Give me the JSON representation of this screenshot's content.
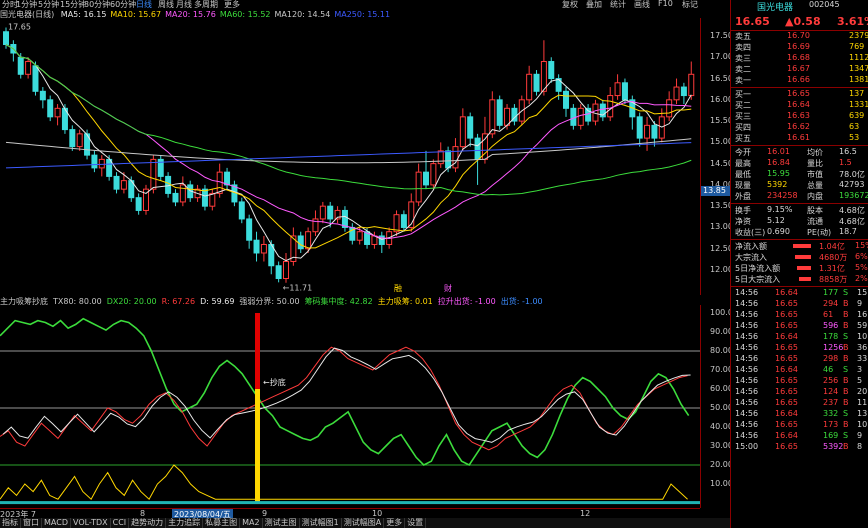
{
  "toolbar": {
    "periods": [
      "分时",
      "1分钟",
      "5分钟",
      "15分钟",
      "30分钟",
      "60分钟",
      "日线",
      "周线",
      "月线",
      "多周期",
      "更多"
    ],
    "active": "日线",
    "right_tools": [
      "复权",
      "叠加",
      "统计",
      "画线",
      "F10",
      "标记"
    ]
  },
  "chart_title": "国光电器(日线)",
  "ma_legend": [
    {
      "label": "MA5: 16.15",
      "color": "#e8e8e8"
    },
    {
      "label": "MA10: 15.67",
      "color": "#ffd700"
    },
    {
      "label": "MA20: 15.76",
      "color": "#ff5aff"
    },
    {
      "label": "MA60: 15.52",
      "color": "#3cdc3c"
    },
    {
      "label": "MA120: 14.54",
      "color": "#c8c8c8"
    },
    {
      "label": "MA250: 15.11",
      "color": "#3c5aff"
    }
  ],
  "price_axis": [
    "17.50",
    "17.00",
    "16.50",
    "16.00",
    "15.50",
    "15.00",
    "14.50",
    "14.00",
    "13.50",
    "13.00",
    "12.50",
    "12.00"
  ],
  "axis_tag": "13.85",
  "annotations": {
    "high": "17.65",
    "low": "11.71",
    "marks": [
      "融",
      "财"
    ]
  },
  "candles": [
    [
      17.6,
      17.3,
      17.7,
      17.2
    ],
    [
      17.3,
      17.1,
      17.4,
      16.9
    ],
    [
      17.0,
      16.6,
      17.1,
      16.5
    ],
    [
      16.6,
      16.9,
      17.0,
      16.5
    ],
    [
      16.8,
      16.2,
      16.9,
      16.1
    ],
    [
      16.2,
      16.0,
      16.3,
      15.8
    ],
    [
      16.0,
      15.6,
      16.1,
      15.5
    ],
    [
      15.6,
      15.8,
      15.9,
      15.4
    ],
    [
      15.8,
      15.3,
      15.9,
      15.2
    ],
    [
      15.3,
      14.9,
      15.4,
      14.8
    ],
    [
      14.9,
      15.2,
      15.3,
      14.8
    ],
    [
      15.2,
      14.7,
      15.3,
      14.6
    ],
    [
      14.7,
      14.4,
      14.8,
      14.3
    ],
    [
      14.4,
      14.6,
      14.7,
      14.2
    ],
    [
      14.6,
      14.2,
      14.7,
      14.1
    ],
    [
      14.2,
      13.9,
      14.3,
      13.8
    ],
    [
      13.9,
      14.1,
      14.3,
      13.8
    ],
    [
      14.1,
      13.7,
      14.2,
      13.6
    ],
    [
      13.7,
      13.4,
      13.8,
      13.3
    ],
    [
      13.4,
      13.9,
      14.0,
      13.3
    ],
    [
      13.9,
      14.6,
      14.7,
      13.8
    ],
    [
      14.6,
      14.2,
      14.7,
      14.1
    ],
    [
      14.2,
      13.8,
      14.3,
      13.7
    ],
    [
      13.8,
      13.6,
      13.9,
      13.5
    ],
    [
      13.6,
      14.0,
      14.2,
      13.5
    ],
    [
      14.0,
      13.7,
      14.1,
      13.6
    ],
    [
      13.7,
      13.9,
      14.0,
      13.6
    ],
    [
      13.9,
      13.5,
      14.0,
      13.4
    ],
    [
      13.5,
      13.8,
      13.9,
      13.4
    ],
    [
      13.8,
      14.3,
      14.5,
      13.7
    ],
    [
      14.3,
      14.0,
      14.4,
      13.9
    ],
    [
      14.0,
      13.6,
      14.1,
      13.5
    ],
    [
      13.6,
      13.2,
      13.7,
      13.1
    ],
    [
      13.2,
      12.7,
      13.3,
      12.5
    ],
    [
      12.7,
      12.4,
      12.9,
      12.2
    ],
    [
      12.4,
      12.6,
      12.8,
      12.2
    ],
    [
      12.6,
      12.1,
      12.7,
      11.9
    ],
    [
      12.1,
      11.8,
      12.2,
      11.71
    ],
    [
      11.8,
      12.2,
      12.4,
      11.7
    ],
    [
      12.2,
      12.8,
      13.0,
      12.1
    ],
    [
      12.8,
      12.5,
      12.9,
      12.4
    ],
    [
      12.5,
      12.9,
      13.0,
      12.4
    ],
    [
      12.9,
      13.2,
      13.4,
      12.8
    ],
    [
      13.2,
      13.5,
      13.6,
      13.1
    ],
    [
      13.5,
      13.2,
      13.6,
      13.0
    ],
    [
      13.2,
      13.4,
      13.5,
      13.1
    ],
    [
      13.4,
      13.0,
      13.5,
      12.9
    ],
    [
      13.0,
      12.7,
      13.1,
      12.6
    ],
    [
      12.7,
      12.9,
      13.0,
      12.6
    ],
    [
      12.9,
      12.6,
      13.0,
      12.5
    ],
    [
      12.6,
      12.8,
      12.9,
      12.5
    ],
    [
      12.8,
      12.6,
      12.9,
      12.4
    ],
    [
      12.6,
      12.9,
      13.0,
      12.5
    ],
    [
      12.9,
      13.3,
      13.4,
      12.8
    ],
    [
      13.3,
      13.0,
      13.4,
      12.9
    ],
    [
      13.0,
      13.6,
      13.8,
      12.9
    ],
    [
      13.6,
      14.3,
      14.5,
      13.5
    ],
    [
      14.3,
      14.0,
      14.8,
      13.9
    ],
    [
      14.0,
      14.5,
      14.6,
      13.9
    ],
    [
      14.5,
      14.8,
      15.0,
      14.4
    ],
    [
      14.8,
      14.4,
      14.9,
      14.3
    ],
    [
      14.4,
      14.9,
      15.1,
      14.3
    ],
    [
      14.9,
      15.6,
      15.8,
      14.8
    ],
    [
      15.6,
      15.1,
      15.7,
      14.9
    ],
    [
      15.1,
      14.6,
      15.2,
      14.0
    ],
    [
      14.6,
      15.2,
      15.6,
      14.5
    ],
    [
      15.2,
      16.0,
      16.2,
      15.1
    ],
    [
      16.0,
      15.4,
      16.1,
      15.3
    ],
    [
      15.4,
      15.8,
      15.9,
      15.3
    ],
    [
      15.8,
      15.5,
      15.9,
      15.4
    ],
    [
      15.5,
      16.0,
      16.1,
      15.4
    ],
    [
      16.0,
      16.6,
      16.8,
      15.9
    ],
    [
      16.6,
      16.2,
      16.7,
      16.1
    ],
    [
      16.2,
      16.9,
      17.4,
      16.1
    ],
    [
      16.9,
      16.5,
      17.0,
      16.4
    ],
    [
      16.5,
      16.2,
      16.6,
      16.0
    ],
    [
      16.2,
      15.8,
      16.3,
      15.6
    ],
    [
      15.8,
      15.4,
      15.9,
      15.3
    ],
    [
      15.4,
      15.8,
      15.9,
      15.3
    ],
    [
      15.8,
      15.5,
      15.9,
      15.4
    ],
    [
      15.5,
      15.9,
      16.0,
      15.4
    ],
    [
      15.9,
      15.6,
      16.0,
      15.5
    ],
    [
      15.6,
      16.1,
      16.3,
      15.5
    ],
    [
      16.1,
      16.4,
      16.6,
      16.0
    ],
    [
      16.4,
      16.0,
      16.5,
      15.9
    ],
    [
      16.0,
      15.6,
      16.1,
      15.3
    ],
    [
      15.6,
      15.1,
      15.7,
      14.9
    ],
    [
      15.1,
      15.4,
      15.6,
      14.8
    ],
    [
      15.4,
      15.1,
      15.5,
      14.9
    ],
    [
      15.1,
      15.6,
      15.8,
      15.0
    ],
    [
      15.6,
      16.0,
      16.2,
      15.5
    ],
    [
      16.0,
      16.3,
      16.5,
      15.9
    ],
    [
      16.3,
      16.1,
      16.4,
      15.9
    ],
    [
      16.1,
      16.6,
      16.9,
      16.0
    ]
  ],
  "indicator_legend": [
    {
      "label": "主力吸筹抄底",
      "color": "#c8c8c8"
    },
    {
      "label": "TX80: 80.00",
      "color": "#c8c8c8"
    },
    {
      "label": "DX20: 20.00",
      "color": "#3cdc3c"
    },
    {
      "label": "R: 67.26",
      "color": "#ff3b3b"
    },
    {
      "label": "D: 59.69",
      "color": "#e8e8e8"
    },
    {
      "label": "强弱分界: 50.00",
      "color": "#c8c8c8"
    },
    {
      "label": "筹码集中度: 42.82",
      "color": "#3cdc3c"
    },
    {
      "label": "主力吸筹: 0.01",
      "color": "#ffd700"
    },
    {
      "label": "拉升出货: -1.00",
      "color": "#ff5aff"
    },
    {
      "label": "出货: -1.00",
      "color": "#3c8cff"
    }
  ],
  "indicator_axis": [
    "100.0",
    "90.00",
    "80.00",
    "70.00",
    "60.00",
    "50.00",
    "40.00",
    "30.00",
    "20.00",
    "10.00"
  ],
  "indicator_annotation": "抄底",
  "date_bar": [
    {
      "text": "2023年 7"
    },
    {
      "text": "8"
    },
    {
      "text": "2023/08/04/五",
      "selected": true
    },
    {
      "text": "9"
    },
    {
      "text": "10"
    },
    {
      "text": "12"
    }
  ],
  "bottom_tabs": [
    "指标",
    "窗口",
    "MACD",
    "VOL-TDX",
    "CCI",
    "趋势动力",
    "主力追踪",
    "私募主图",
    "MA2",
    "测试主图",
    "测试幅图1",
    "测试幅图A",
    "更多",
    "设置"
  ],
  "quote": {
    "name": "国光电器",
    "code": "002045",
    "price": "16.65",
    "change": "▲0.58",
    "pct": "3.61%",
    "asks": [
      {
        "label": "卖五",
        "price": "16.70",
        "vol": "2379"
      },
      {
        "label": "卖四",
        "price": "16.69",
        "vol": "769"
      },
      {
        "label": "卖三",
        "price": "16.68",
        "vol": "1112"
      },
      {
        "label": "卖二",
        "price": "16.67",
        "vol": "1347"
      },
      {
        "label": "卖一",
        "price": "16.66",
        "vol": "1381"
      }
    ],
    "bids": [
      {
        "label": "买一",
        "price": "16.65",
        "vol": "137"
      },
      {
        "label": "买二",
        "price": "16.64",
        "vol": "1331"
      },
      {
        "label": "买三",
        "price": "16.63",
        "vol": "639"
      },
      {
        "label": "买四",
        "price": "16.62",
        "vol": "63"
      },
      {
        "label": "买五",
        "price": "16.61",
        "vol": "53"
      }
    ],
    "stats": [
      {
        "k1": "今开",
        "v1": "16.01",
        "k2": "均价",
        "v2": "16.5"
      },
      {
        "k1": "最高",
        "v1": "16.84",
        "k2": "量比",
        "v2": "1.5"
      },
      {
        "k1": "最低",
        "v1": "15.95",
        "k2": "市值",
        "v2": "78.0亿"
      },
      {
        "k1": "现量",
        "v1": "5392",
        "k2": "总量",
        "v2": "42793"
      },
      {
        "k1": "外盘",
        "v1": "234258",
        "k2": "内盘",
        "v2": "193672"
      },
      {
        "k1": "换手",
        "v1": "9.15%",
        "k2": "股本",
        "v2": "4.68亿"
      },
      {
        "k1": "净资",
        "v1": "5.12",
        "k2": "流通",
        "v2": "4.68亿"
      },
      {
        "k1": "收益(三)",
        "v1": "0.690",
        "k2": "PE(动)",
        "v2": "18.7"
      }
    ],
    "flows": [
      {
        "label": "净流入额",
        "val": "1.04亿",
        "pct": "15%"
      },
      {
        "label": "大宗流入",
        "val": "4680万",
        "pct": "6%"
      },
      {
        "label": "5日净流入额",
        "val": "1.31亿",
        "pct": "5%"
      },
      {
        "label": "5日大宗流入",
        "val": "8858万",
        "pct": "2%"
      }
    ],
    "ticks": [
      [
        "14:56",
        "16.64",
        "177",
        "S",
        "15"
      ],
      [
        "14:56",
        "16.65",
        "294",
        "B",
        "9"
      ],
      [
        "14:56",
        "16.65",
        "61",
        "B",
        "16"
      ],
      [
        "14:56",
        "16.65",
        "596",
        "B",
        "59"
      ],
      [
        "14:56",
        "16.64",
        "178",
        "S",
        "10"
      ],
      [
        "14:56",
        "16.65",
        "1256",
        "B",
        "36"
      ],
      [
        "14:56",
        "16.65",
        "298",
        "B",
        "33"
      ],
      [
        "14:56",
        "16.64",
        "46",
        "S",
        "3"
      ],
      [
        "14:56",
        "16.65",
        "256",
        "B",
        "5"
      ],
      [
        "14:56",
        "16.65",
        "124",
        "B",
        "20"
      ],
      [
        "14:56",
        "16.65",
        "237",
        "B",
        "11"
      ],
      [
        "14:56",
        "16.64",
        "332",
        "S",
        "13"
      ],
      [
        "14:56",
        "16.65",
        "173",
        "B",
        "10"
      ],
      [
        "14:56",
        "16.64",
        "169",
        "S",
        "9"
      ],
      [
        "15:00",
        "16.65",
        "5392",
        "B",
        "8"
      ]
    ]
  }
}
